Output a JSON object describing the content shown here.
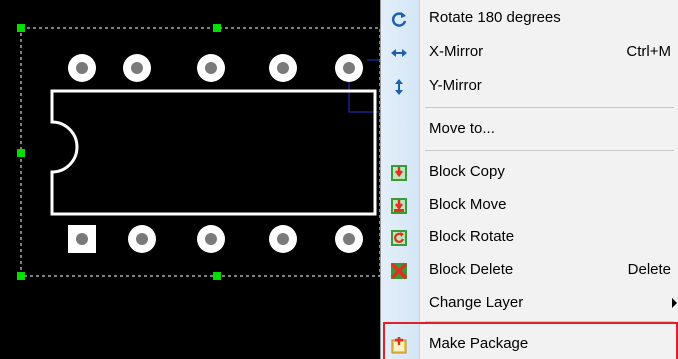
{
  "menu": {
    "items": [
      {
        "label": "Rotate 180 degrees",
        "shortcut": "",
        "icon": "rotate-icon"
      },
      {
        "label": "X-Mirror",
        "shortcut": "Ctrl+M",
        "icon": "x-mirror-icon"
      },
      {
        "label": "Y-Mirror",
        "shortcut": "",
        "icon": "y-mirror-icon"
      },
      {
        "label": "Move to...",
        "shortcut": "",
        "icon": ""
      },
      {
        "label": "Block Copy",
        "shortcut": "",
        "icon": "block-copy-icon"
      },
      {
        "label": "Block Move",
        "shortcut": "",
        "icon": "block-move-icon"
      },
      {
        "label": "Block Rotate",
        "shortcut": "",
        "icon": "block-rotate-icon"
      },
      {
        "label": "Block Delete",
        "shortcut": "Delete",
        "icon": "block-delete-icon"
      },
      {
        "label": "Change Layer",
        "shortcut": "",
        "icon": "",
        "has_submenu": true
      },
      {
        "label": "Make Package",
        "shortcut": "",
        "icon": "make-package-icon",
        "highlighted": true
      }
    ]
  },
  "colors": {
    "canvas_bg": "#000000",
    "selection_handle": "#00e000",
    "pad": "#ffffff",
    "pad_hole": "#7a7a7a",
    "highlight_box": "#e0202a"
  }
}
